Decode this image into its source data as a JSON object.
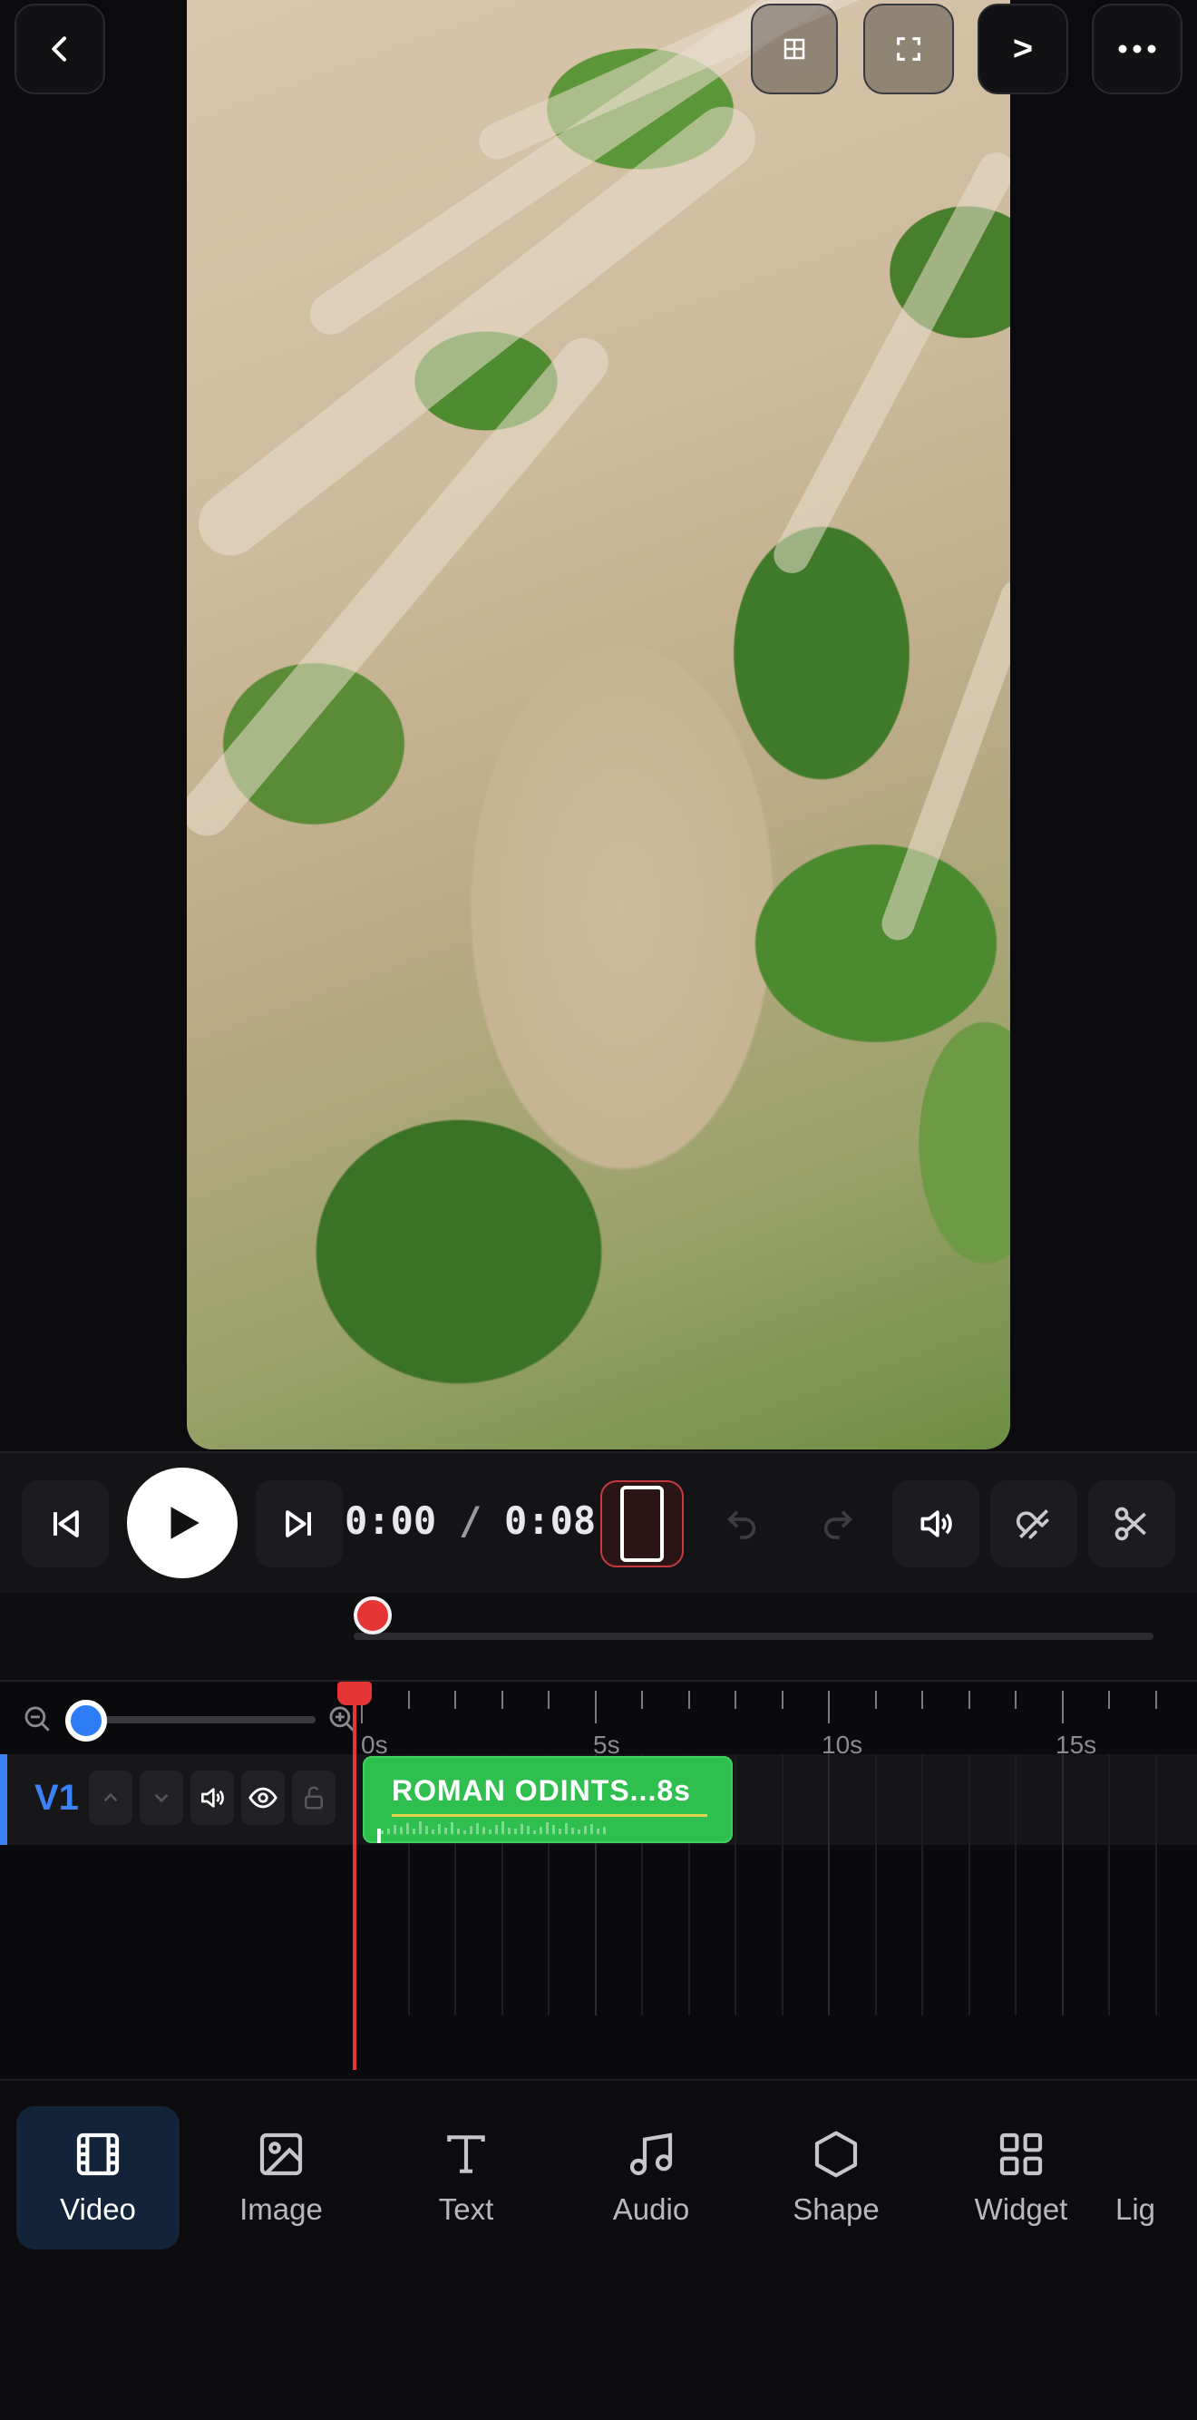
{
  "top_bar": {
    "back_icon": "chevron-left-icon",
    "layout_icon": "grid-icon",
    "fullscreen_icon": "fullscreen-icon",
    "next_label": ">",
    "more_icon": "more-horizontal-icon"
  },
  "controls": {
    "current_time": "0:00",
    "separator": "/",
    "duration": "0:08",
    "icons": [
      "skip-back-icon",
      "play-icon",
      "skip-forward-icon",
      "aspect-ratio-icon",
      "undo-icon",
      "redo-icon",
      "volume-icon",
      "magnet-icon",
      "scissors-icon"
    ]
  },
  "scrub": {
    "position": 0
  },
  "timeline": {
    "zoom_level": 0.05,
    "ruler_labels": [
      "0s",
      "5s",
      "10s",
      "15s"
    ],
    "track": {
      "name": "V1",
      "clip_label": "ROMAN ODINTS...8s"
    }
  },
  "tabs": [
    {
      "label": "Video",
      "icon": "film-icon",
      "active": true
    },
    {
      "label": "Image",
      "icon": "image-icon",
      "active": false
    },
    {
      "label": "Text",
      "icon": "text-icon",
      "active": false
    },
    {
      "label": "Audio",
      "icon": "music-icon",
      "active": false
    },
    {
      "label": "Shape",
      "icon": "hexagon-icon",
      "active": false
    },
    {
      "label": "Widget",
      "icon": "widget-grid-icon",
      "active": false
    },
    {
      "label": "Lig",
      "icon": "",
      "active": false
    }
  ],
  "colors": {
    "accent_blue": "#3b82f6",
    "clip_green": "#2fbf4f",
    "playhead_red": "#e53535"
  }
}
